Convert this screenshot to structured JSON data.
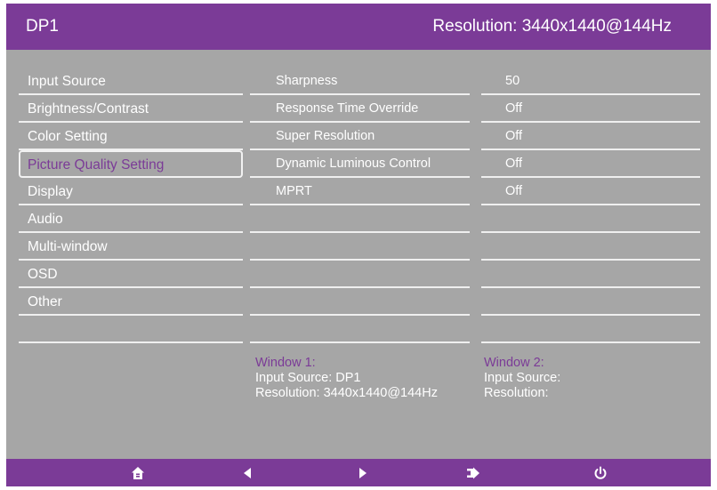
{
  "header": {
    "source": "DP1",
    "resolution": "Resolution: 3440x1440@144Hz"
  },
  "menu": {
    "items": [
      {
        "label": "Input Source"
      },
      {
        "label": "Brightness/Contrast"
      },
      {
        "label": "Color Setting"
      },
      {
        "label": "Picture Quality Setting",
        "selected": true
      },
      {
        "label": "Display"
      },
      {
        "label": "Audio"
      },
      {
        "label": "Multi-window"
      },
      {
        "label": "OSD"
      },
      {
        "label": "Other"
      }
    ]
  },
  "settings": [
    {
      "name": "Sharpness",
      "value": "50"
    },
    {
      "name": "Response Time Override",
      "value": "Off"
    },
    {
      "name": "Super Resolution",
      "value": "Off"
    },
    {
      "name": "Dynamic Luminous Control",
      "value": "Off"
    },
    {
      "name": "MPRT",
      "value": "Off"
    }
  ],
  "window1": {
    "title": "Window 1:",
    "input": "Input Source: DP1",
    "resolution": "Resolution: 3440x1440@144Hz"
  },
  "window2": {
    "title": "Window 2:",
    "input": "Input Source:",
    "resolution": "Resolution:"
  },
  "footer": {
    "buttons": [
      "home-icon",
      "left-arrow-icon",
      "right-arrow-icon",
      "exit-icon",
      "power-icon"
    ]
  },
  "colors": {
    "accent": "#7b3b97",
    "panel": "#a6a6a6",
    "text": "#ffffff"
  }
}
